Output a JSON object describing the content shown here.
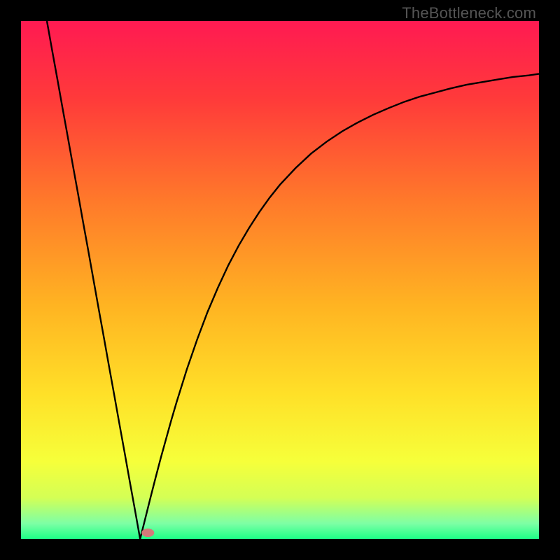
{
  "attribution": "TheBottleneck.com",
  "gradient": {
    "stops": [
      {
        "offset": 0.0,
        "color": "#ff1a52"
      },
      {
        "offset": 0.15,
        "color": "#ff3a3a"
      },
      {
        "offset": 0.35,
        "color": "#ff7a2a"
      },
      {
        "offset": 0.55,
        "color": "#ffb422"
      },
      {
        "offset": 0.72,
        "color": "#ffe028"
      },
      {
        "offset": 0.85,
        "color": "#f6ff3a"
      },
      {
        "offset": 0.92,
        "color": "#d4ff55"
      },
      {
        "offset": 0.97,
        "color": "#7dffa5"
      },
      {
        "offset": 1.0,
        "color": "#1dff86"
      }
    ]
  },
  "chart_data": {
    "type": "line",
    "title": "",
    "xlabel": "",
    "ylabel": "",
    "xlim": [
      0,
      100
    ],
    "ylim": [
      0,
      100
    ],
    "notch_x": 23,
    "marker": {
      "x": 24.5,
      "y": 1.2,
      "color": "#d47a7a"
    },
    "series": [
      {
        "name": "curve",
        "points": [
          {
            "x": 5.0,
            "y": 100.0
          },
          {
            "x": 6.0,
            "y": 94.4
          },
          {
            "x": 7.0,
            "y": 88.9
          },
          {
            "x": 8.0,
            "y": 83.3
          },
          {
            "x": 9.0,
            "y": 77.8
          },
          {
            "x": 10.0,
            "y": 72.2
          },
          {
            "x": 11.0,
            "y": 66.7
          },
          {
            "x": 12.0,
            "y": 61.1
          },
          {
            "x": 13.0,
            "y": 55.6
          },
          {
            "x": 14.0,
            "y": 50.0
          },
          {
            "x": 15.0,
            "y": 44.4
          },
          {
            "x": 16.0,
            "y": 38.9
          },
          {
            "x": 17.0,
            "y": 33.3
          },
          {
            "x": 18.0,
            "y": 27.8
          },
          {
            "x": 19.0,
            "y": 22.2
          },
          {
            "x": 20.0,
            "y": 16.7
          },
          {
            "x": 21.0,
            "y": 11.1
          },
          {
            "x": 22.0,
            "y": 5.6
          },
          {
            "x": 23.0,
            "y": 0.0
          },
          {
            "x": 24.0,
            "y": 4.0
          },
          {
            "x": 25.0,
            "y": 8.0
          },
          {
            "x": 26.0,
            "y": 11.9
          },
          {
            "x": 27.0,
            "y": 15.7
          },
          {
            "x": 28.0,
            "y": 19.3
          },
          {
            "x": 29.0,
            "y": 22.9
          },
          {
            "x": 30.0,
            "y": 26.3
          },
          {
            "x": 32.0,
            "y": 32.7
          },
          {
            "x": 34.0,
            "y": 38.5
          },
          {
            "x": 36.0,
            "y": 43.8
          },
          {
            "x": 38.0,
            "y": 48.5
          },
          {
            "x": 40.0,
            "y": 52.8
          },
          {
            "x": 42.0,
            "y": 56.6
          },
          {
            "x": 44.0,
            "y": 60.0
          },
          {
            "x": 46.0,
            "y": 63.1
          },
          {
            "x": 48.0,
            "y": 65.9
          },
          {
            "x": 50.0,
            "y": 68.4
          },
          {
            "x": 53.0,
            "y": 71.6
          },
          {
            "x": 56.0,
            "y": 74.4
          },
          {
            "x": 59.0,
            "y": 76.7
          },
          {
            "x": 62.0,
            "y": 78.7
          },
          {
            "x": 65.0,
            "y": 80.4
          },
          {
            "x": 68.0,
            "y": 81.9
          },
          {
            "x": 71.0,
            "y": 83.2
          },
          {
            "x": 74.0,
            "y": 84.4
          },
          {
            "x": 77.0,
            "y": 85.4
          },
          {
            "x": 80.0,
            "y": 86.2
          },
          {
            "x": 83.0,
            "y": 87.0
          },
          {
            "x": 86.0,
            "y": 87.7
          },
          {
            "x": 89.0,
            "y": 88.2
          },
          {
            "x": 92.0,
            "y": 88.7
          },
          {
            "x": 95.0,
            "y": 89.2
          },
          {
            "x": 98.0,
            "y": 89.5
          },
          {
            "x": 100.0,
            "y": 89.8
          }
        ]
      }
    ]
  }
}
